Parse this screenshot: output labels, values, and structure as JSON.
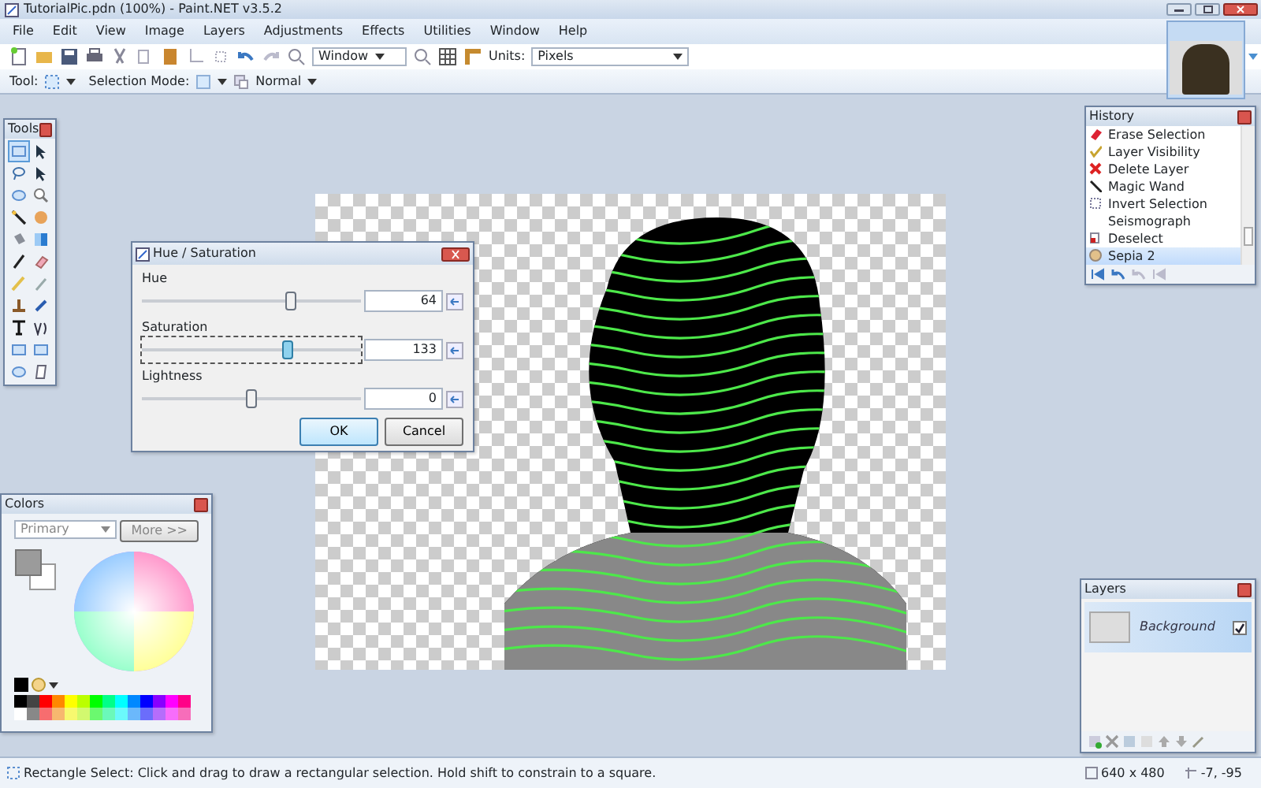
{
  "window": {
    "title": "TutorialPic.pdn (100%) - Paint.NET v3.5.2"
  },
  "menu": [
    "File",
    "Edit",
    "View",
    "Image",
    "Layers",
    "Adjustments",
    "Effects",
    "Utilities",
    "Window",
    "Help"
  ],
  "toolbar": {
    "zoom": "Window",
    "units_label": "Units:",
    "units": "Pixels",
    "tool_label": "Tool:",
    "selection_mode_label": "Selection Mode:",
    "blend_mode": "Normal"
  },
  "tools": {
    "title": "Tools",
    "items": [
      {
        "kind": "rect",
        "selected": true
      },
      {
        "kind": "move",
        "selected": false
      },
      {
        "kind": "lasso",
        "selected": false
      },
      {
        "kind": "move",
        "selected": false
      },
      {
        "kind": "ellipse",
        "selected": false
      },
      {
        "kind": "zoom",
        "selected": false
      },
      {
        "kind": "wand",
        "selected": false
      },
      {
        "kind": "hand",
        "selected": false
      },
      {
        "kind": "bucket",
        "selected": false
      },
      {
        "kind": "gradient",
        "selected": false
      },
      {
        "kind": "brush",
        "selected": false
      },
      {
        "kind": "eraser",
        "selected": false
      },
      {
        "kind": "pencil",
        "selected": false
      },
      {
        "kind": "picker",
        "selected": false
      },
      {
        "kind": "stamp",
        "selected": false
      },
      {
        "kind": "recolor",
        "selected": false
      },
      {
        "kind": "text",
        "selected": false
      },
      {
        "kind": "line",
        "selected": false
      },
      {
        "kind": "rect",
        "selected": false
      },
      {
        "kind": "rect",
        "selected": false
      },
      {
        "kind": "ellipse",
        "selected": false
      },
      {
        "kind": "freeform",
        "selected": false
      }
    ]
  },
  "dialog": {
    "title": "Hue / Saturation",
    "sliders": [
      {
        "label": "Hue",
        "value": "64",
        "level": 0.68,
        "focused": false
      },
      {
        "label": "Saturation",
        "value": "133",
        "level": 0.665,
        "focused": true
      },
      {
        "label": "Lightness",
        "value": "0",
        "level": 0.5,
        "focused": false
      }
    ],
    "buttons": [
      {
        "label": "OK",
        "default": true
      },
      {
        "label": "Cancel",
        "default": false
      }
    ]
  },
  "history": {
    "title": "History",
    "items": [
      {
        "label": "Erase Selection",
        "kind": "erase",
        "selected": false
      },
      {
        "label": "Layer Visibility",
        "kind": "visibility",
        "selected": false
      },
      {
        "label": "Delete Layer",
        "kind": "delete",
        "selected": false
      },
      {
        "label": "Magic Wand",
        "kind": "wand",
        "selected": false
      },
      {
        "label": "Invert Selection",
        "kind": "invert",
        "selected": false
      },
      {
        "label": "Seismograph",
        "kind": "none",
        "selected": false
      },
      {
        "label": "Deselect",
        "kind": "deselect",
        "selected": false
      },
      {
        "label": "Sepia 2",
        "kind": "effect",
        "selected": true
      }
    ]
  },
  "colors": {
    "title": "Colors",
    "target": "Primary",
    "more": "More >>"
  },
  "layers": {
    "title": "Layers",
    "items": [
      {
        "name": "Background",
        "visible": true,
        "selected": true
      }
    ]
  },
  "status_bar": {
    "hint": "Rectangle Select: Click and drag to draw a rectangular selection. Hold shift to constrain to a square.",
    "size": "640 x 480",
    "position": "-7, -95"
  }
}
